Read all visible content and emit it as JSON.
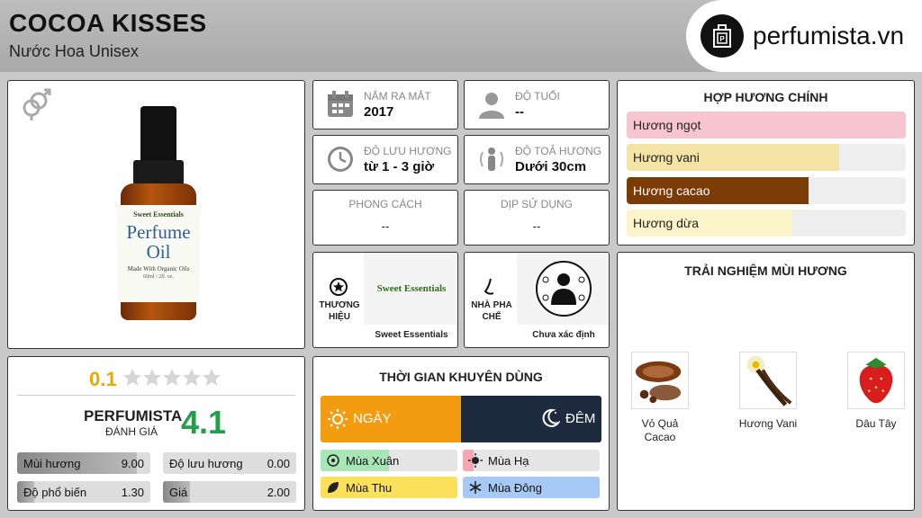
{
  "header": {
    "title": "COCOA KISSES",
    "subtitle": "Nước Hoa Unisex",
    "logo_text": "perfumista.vn"
  },
  "info": {
    "release": {
      "label": "NĂM RA MẮT",
      "value": "2017"
    },
    "age": {
      "label": "ĐỘ TUỔI",
      "value": "--"
    },
    "longevity": {
      "label": "ĐỘ LƯU HƯƠNG",
      "value": "từ 1 - 3 giờ"
    },
    "sillage": {
      "label": "ĐỘ TOẢ HƯƠNG",
      "value": "Dưới 30cm"
    },
    "style": {
      "label": "PHONG CÁCH",
      "value": "--"
    },
    "occasion": {
      "label": "DỊP SỬ DỤNG",
      "value": "--"
    },
    "brand": {
      "label": "THƯƠNG HIỆU",
      "name": "Sweet Essentials",
      "logo_text": "Sweet Essentials"
    },
    "perfumer": {
      "label": "NHÀ PHA CHẾ",
      "name": "Chưa xác định"
    }
  },
  "product": {
    "bottle_brand": "Sweet Essentials",
    "bottle_line1": "Perfume",
    "bottle_line2": "Oil",
    "bottle_line3": "Made With Organic Oils",
    "bottle_size": "60ml / 2fl. oz."
  },
  "accords": {
    "title": "HỢP HƯƠNG CHÍNH",
    "items": [
      {
        "label": "Hương ngọt",
        "fraction": 1.0,
        "color": "#f7c5cf",
        "text_color": "#222"
      },
      {
        "label": "Hương vani",
        "fraction": 0.76,
        "color": "#f3e3a5",
        "text_color": "#222"
      },
      {
        "label": "Hương cacao",
        "fraction": 0.65,
        "color": "#7a3b06",
        "text_color": "#ffffff"
      },
      {
        "label": "Hương dừa",
        "fraction": 0.59,
        "color": "#fbf5c9",
        "text_color": "#222"
      }
    ]
  },
  "notes": {
    "title": "TRẢI NGHIỆM MÙI HƯƠNG",
    "items": [
      {
        "label": "Vỏ Quả Cacao",
        "icon": "cacao-icon"
      },
      {
        "label": "Hương Vani",
        "icon": "vanilla-icon"
      },
      {
        "label": "Dâu Tây",
        "icon": "strawberry-icon"
      }
    ]
  },
  "rating": {
    "user_score": "0.1",
    "stars_filled": 0,
    "stars_total": 5,
    "perfumista_label": "PERFUMISTA",
    "perfumista_sub": "ĐÁNH GIÁ",
    "perfumista_score": "4.1",
    "stats": [
      {
        "label": "Mùi hương",
        "value": "9.00",
        "fraction": 0.9
      },
      {
        "label": "Độ lưu hương",
        "value": "0.00",
        "fraction": 0.0
      },
      {
        "label": "Độ phổ biến",
        "value": "1.30",
        "fraction": 0.13
      },
      {
        "label": "Giá",
        "value": "2.00",
        "fraction": 0.2
      }
    ]
  },
  "time": {
    "title": "THỜI GIAN KHUYÊN DÙNG",
    "day_label": "NGÀY",
    "night_label": "ĐÊM",
    "day_color": "#f39c12",
    "night_color": "#1e2a3d",
    "seasons": [
      {
        "label": "Mùa Xuân",
        "fraction": 0.5,
        "color": "#a8e6b8"
      },
      {
        "label": "Mùa Hạ",
        "fraction": 0.08,
        "color": "#f4a6b3"
      },
      {
        "label": "Mùa Thu",
        "fraction": 1.0,
        "color": "#fbe05a"
      },
      {
        "label": "Mùa Đông",
        "fraction": 1.0,
        "color": "#a7c9f5"
      }
    ]
  }
}
